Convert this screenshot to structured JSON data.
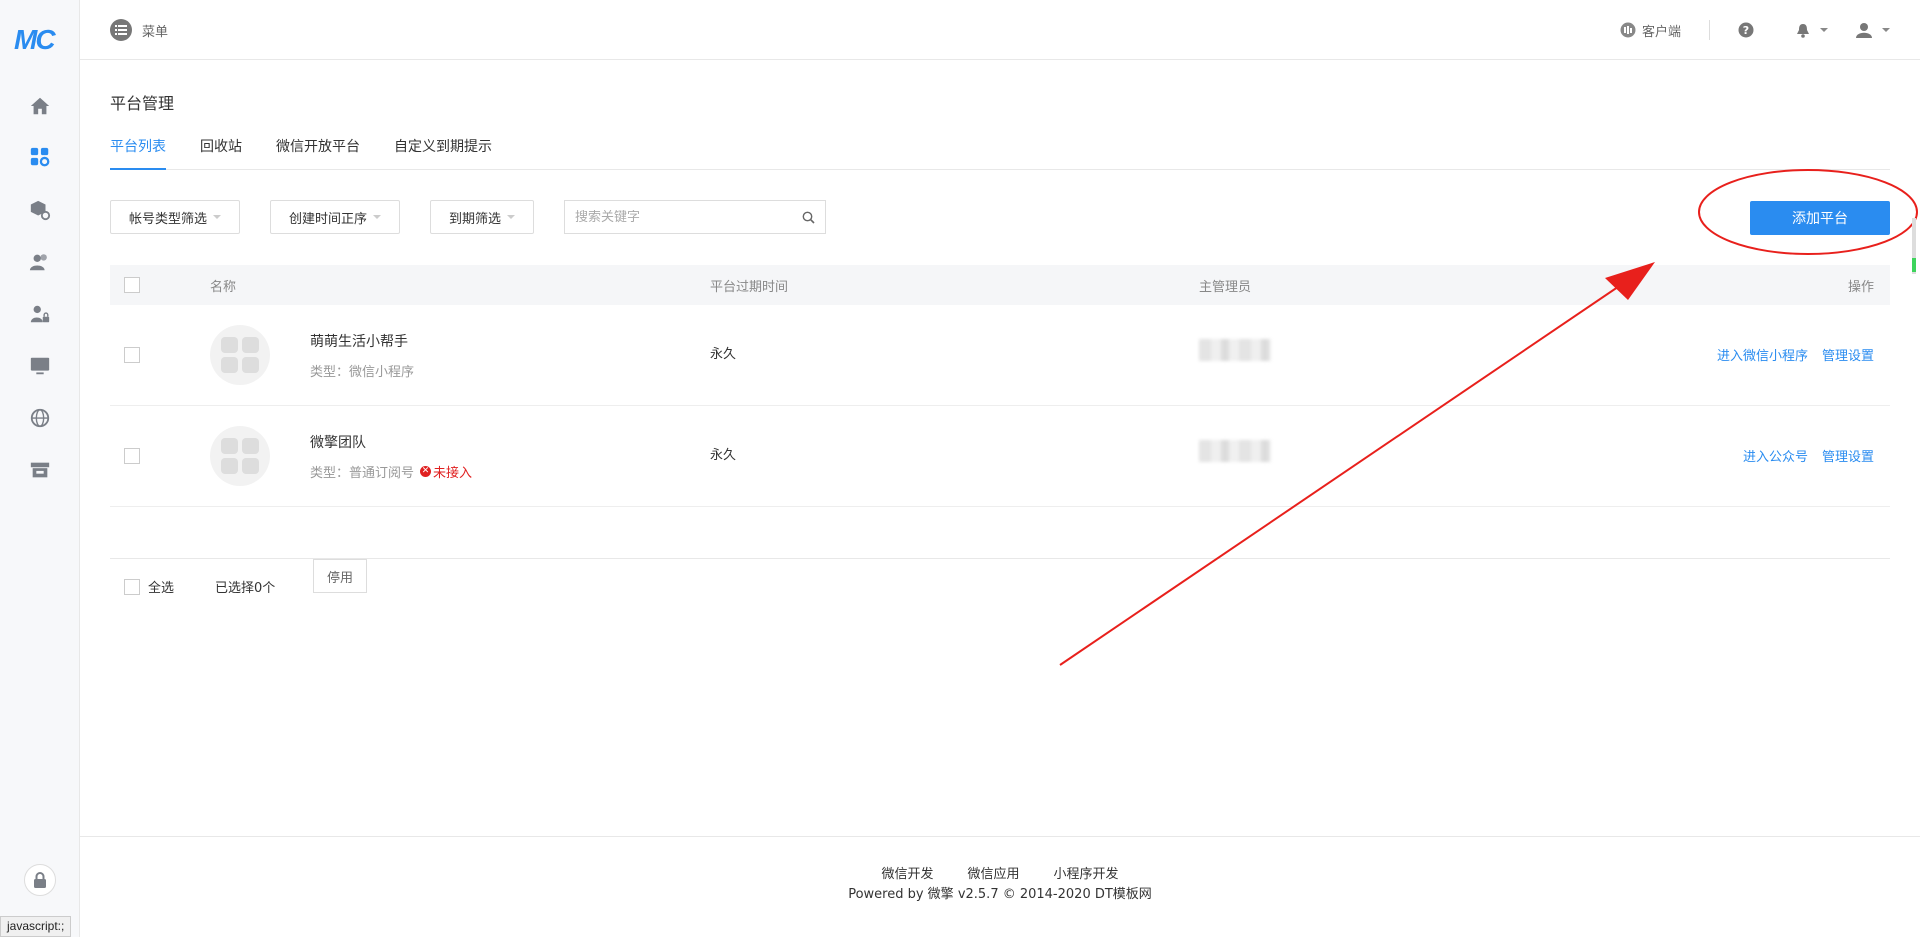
{
  "logo": "MC",
  "topbar": {
    "menu_label": "菜单",
    "client_label": "客户端"
  },
  "page": {
    "title": "平台管理",
    "tabs": [
      "平台列表",
      "回收站",
      "微信开放平台",
      "自定义到期提示"
    ]
  },
  "filters": {
    "account_type": "帐号类型筛选",
    "created_order": "创建时间正序",
    "expire": "到期筛选",
    "search_placeholder": "搜索关键字"
  },
  "add_button": "添加平台",
  "table": {
    "headers": {
      "name": "名称",
      "expire": "平台过期时间",
      "admin": "主管理员",
      "ops": "操作"
    },
    "rows": [
      {
        "name": "萌萌生活小帮手",
        "type": "类型：微信小程序",
        "warning": "",
        "expire": "永久",
        "op_enter": "进入微信小程序",
        "op_manage": "管理设置"
      },
      {
        "name": "微擎团队",
        "type": "类型：普通订阅号",
        "warning": "未接入",
        "expire": "永久",
        "op_enter": "进入公众号",
        "op_manage": "管理设置"
      }
    ]
  },
  "bulk": {
    "select_all": "全选",
    "selected": "已选择0个",
    "disable": "停用"
  },
  "footer": {
    "links": [
      "微信开发",
      "微信应用",
      "小程序开发"
    ],
    "powered": "Powered by 微擎 v2.5.7 © 2014-2020 DT模板网"
  },
  "status_bar": "javascript:;",
  "colors": {
    "accent": "#2a8cf0",
    "annotation": "#e8201c",
    "warning": "#e02020"
  }
}
